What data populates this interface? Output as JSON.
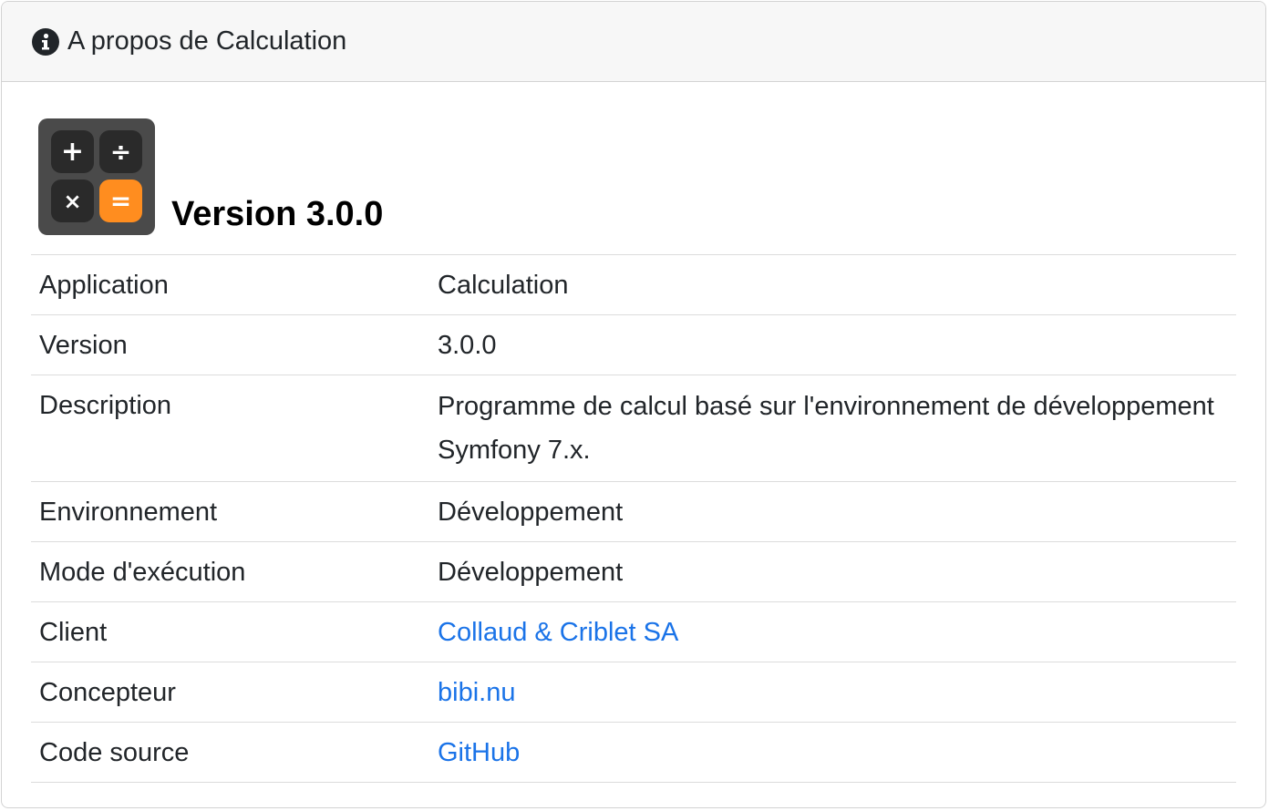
{
  "header": {
    "icon": "info-circle-icon",
    "title": "A propos de Calculation"
  },
  "hero": {
    "app_icon": "calculator-icon",
    "keys": [
      "+",
      "÷",
      "×",
      "="
    ],
    "version_title": "Version 3.0.0"
  },
  "rows": [
    {
      "label": "Application",
      "value": "Calculation"
    },
    {
      "label": "Version",
      "value": "3.0.0"
    },
    {
      "label": "Description",
      "value": "Programme de calcul basé sur l'environnement de développe­ment Symfony 7.x."
    },
    {
      "label": "Environnement",
      "value": "Développement"
    },
    {
      "label": "Mode d'exécution",
      "value": "Développement"
    },
    {
      "label": "Client",
      "value": "Collaud & Criblet SA"
    },
    {
      "label": "Concepteur",
      "value": "bibi.nu"
    },
    {
      "label": "Code source",
      "value": "GitHub"
    }
  ],
  "colors": {
    "link": "#1a73e8",
    "header_bg": "#f7f7f7",
    "accent_key": "#ff8d1f"
  }
}
